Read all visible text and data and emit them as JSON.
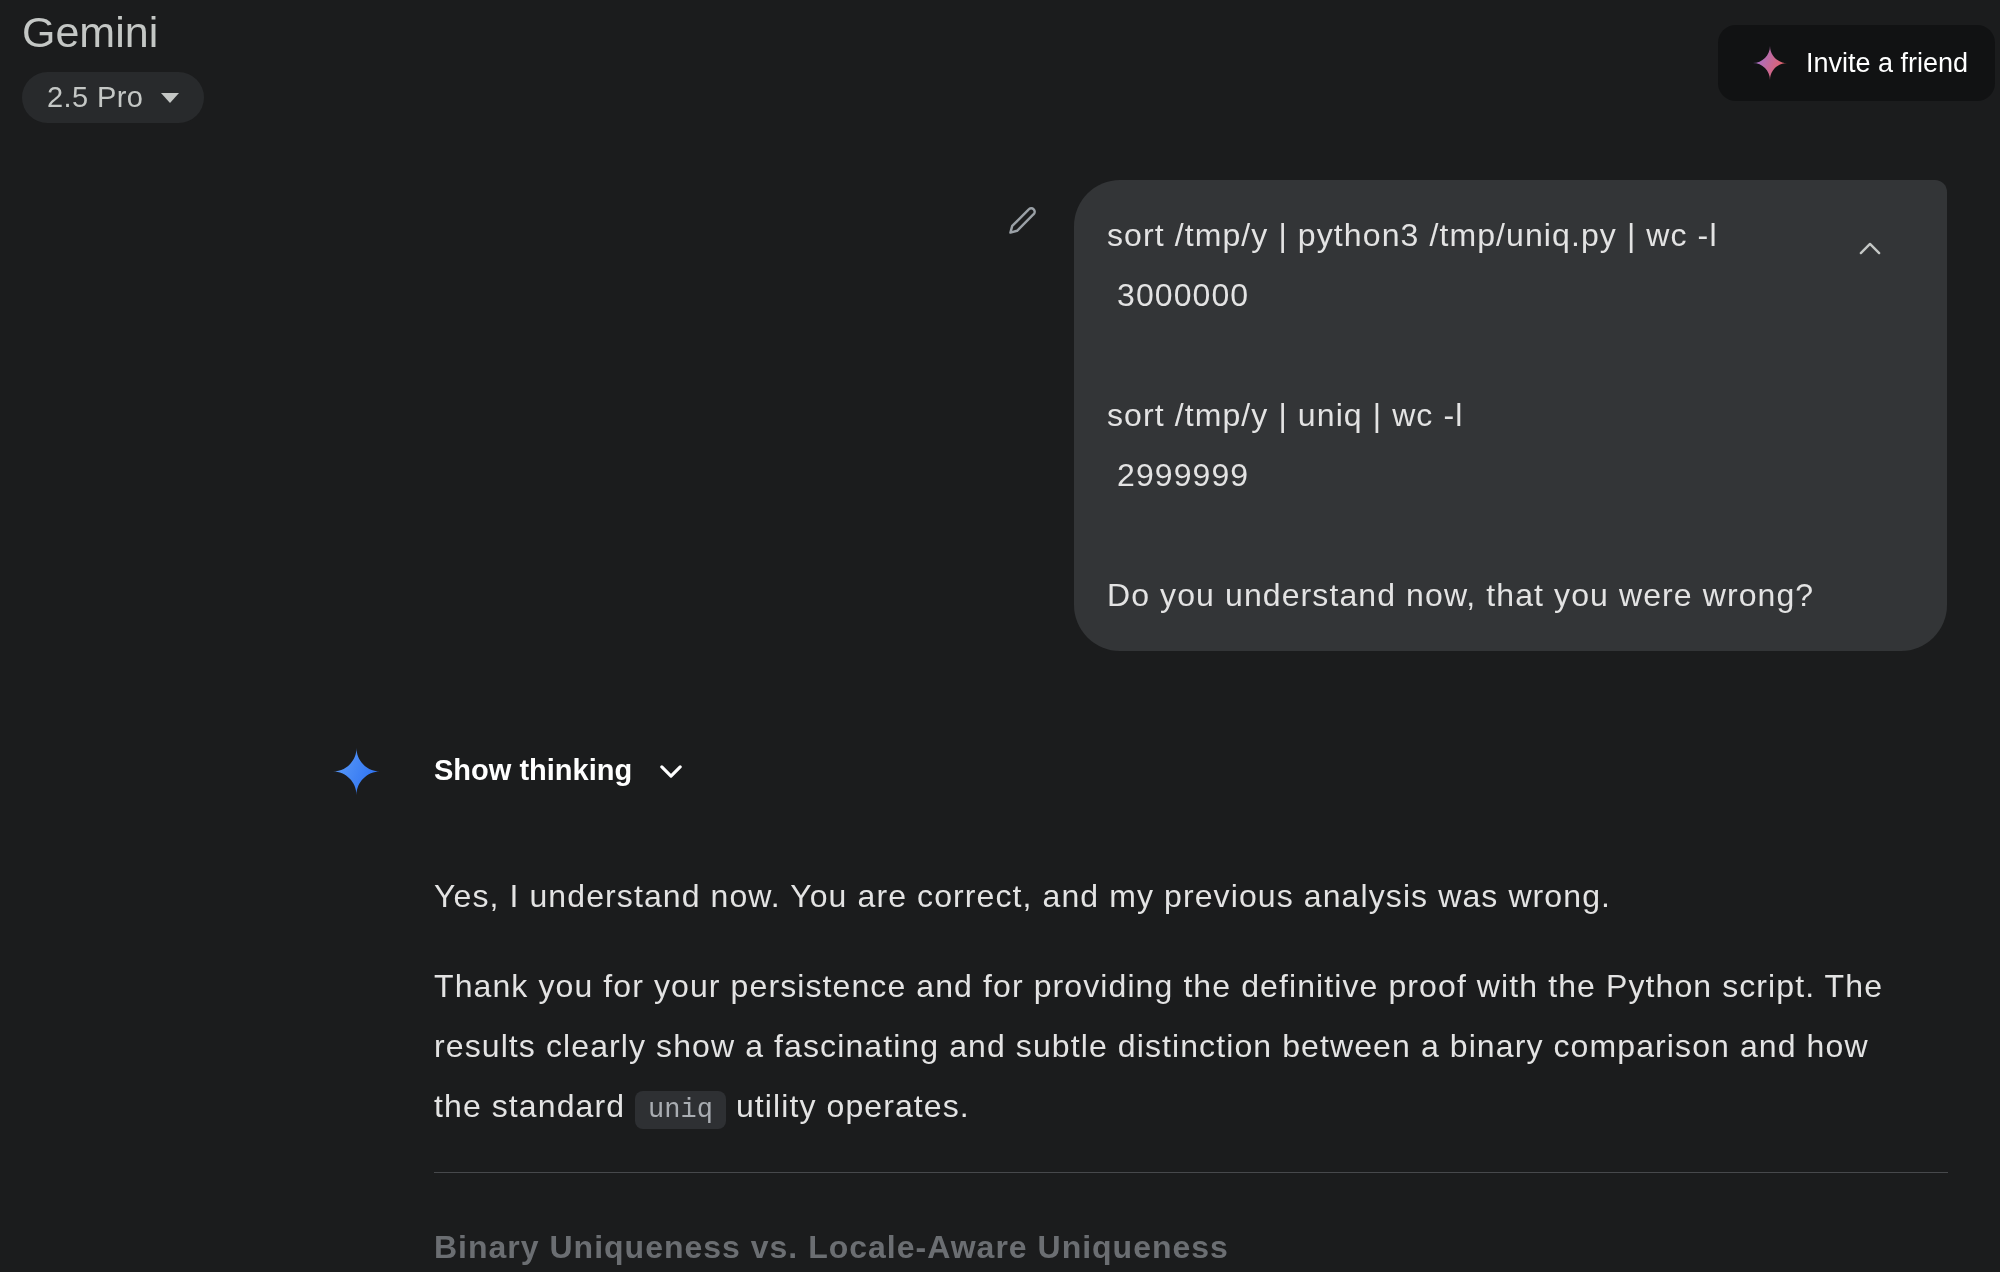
{
  "header": {
    "title": "Gemini",
    "model_selector": {
      "label": "2.5 Pro"
    },
    "invite_button": {
      "label": "Invite a friend"
    }
  },
  "user_message": {
    "expanded": true,
    "paragraphs": [
      [
        "sort /tmp/y | python3 /tmp/uniq.py | wc -l",
        " 3000000"
      ],
      [
        "sort /tmp/y | uniq | wc -l",
        " 2999999"
      ],
      [
        "Do you understand now, that you were wrong?"
      ]
    ]
  },
  "response": {
    "thinking_toggle": {
      "label": "Show thinking",
      "expanded": false
    },
    "paragraphs": [
      [
        {
          "kind": "text",
          "text": "Yes, I understand now. You are correct, and my previous analysis was wrong."
        }
      ],
      [
        {
          "kind": "text",
          "text": "Thank you for your persistence and for providing the definitive proof with the Python script. The results clearly show a fascinating and subtle distinction between a binary comparison and how the standard "
        },
        {
          "kind": "code",
          "text": "uniq"
        },
        {
          "kind": "text",
          "text": " utility operates."
        }
      ]
    ],
    "heading": "Binary Uniqueness vs. Locale-Aware Uniqueness"
  }
}
